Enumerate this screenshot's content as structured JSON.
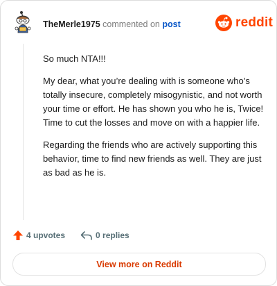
{
  "header": {
    "username": "TheMerle1975",
    "commented_on": "commented on",
    "post_link": "post",
    "brand_word": "reddit"
  },
  "comment": {
    "paragraphs": [
      "So much NTA!!!",
      "My dear, what you’re dealing with is someone who’s totally insecure, completely misogynistic, and not worth your time or effort. He has shown you who he is, Twice! Time to cut the losses and move on with a happier life.",
      "Regarding the friends who are actively supporting this behavior, time to find new friends as well. They are just as bad as he is."
    ]
  },
  "footer": {
    "upvotes": "4 upvotes",
    "replies": "0 replies"
  },
  "actions": {
    "view_more": "View more on Reddit"
  },
  "colors": {
    "brand": "#ff4500",
    "link": "#0a58c8",
    "view_more_text": "#d93a00",
    "muted": "#576f76"
  },
  "icons": {
    "avatar": "snoo-avatar-icon",
    "brand": "reddit-logo-icon",
    "upvote": "upvote-arrow-icon",
    "reply": "reply-arrow-icon"
  }
}
